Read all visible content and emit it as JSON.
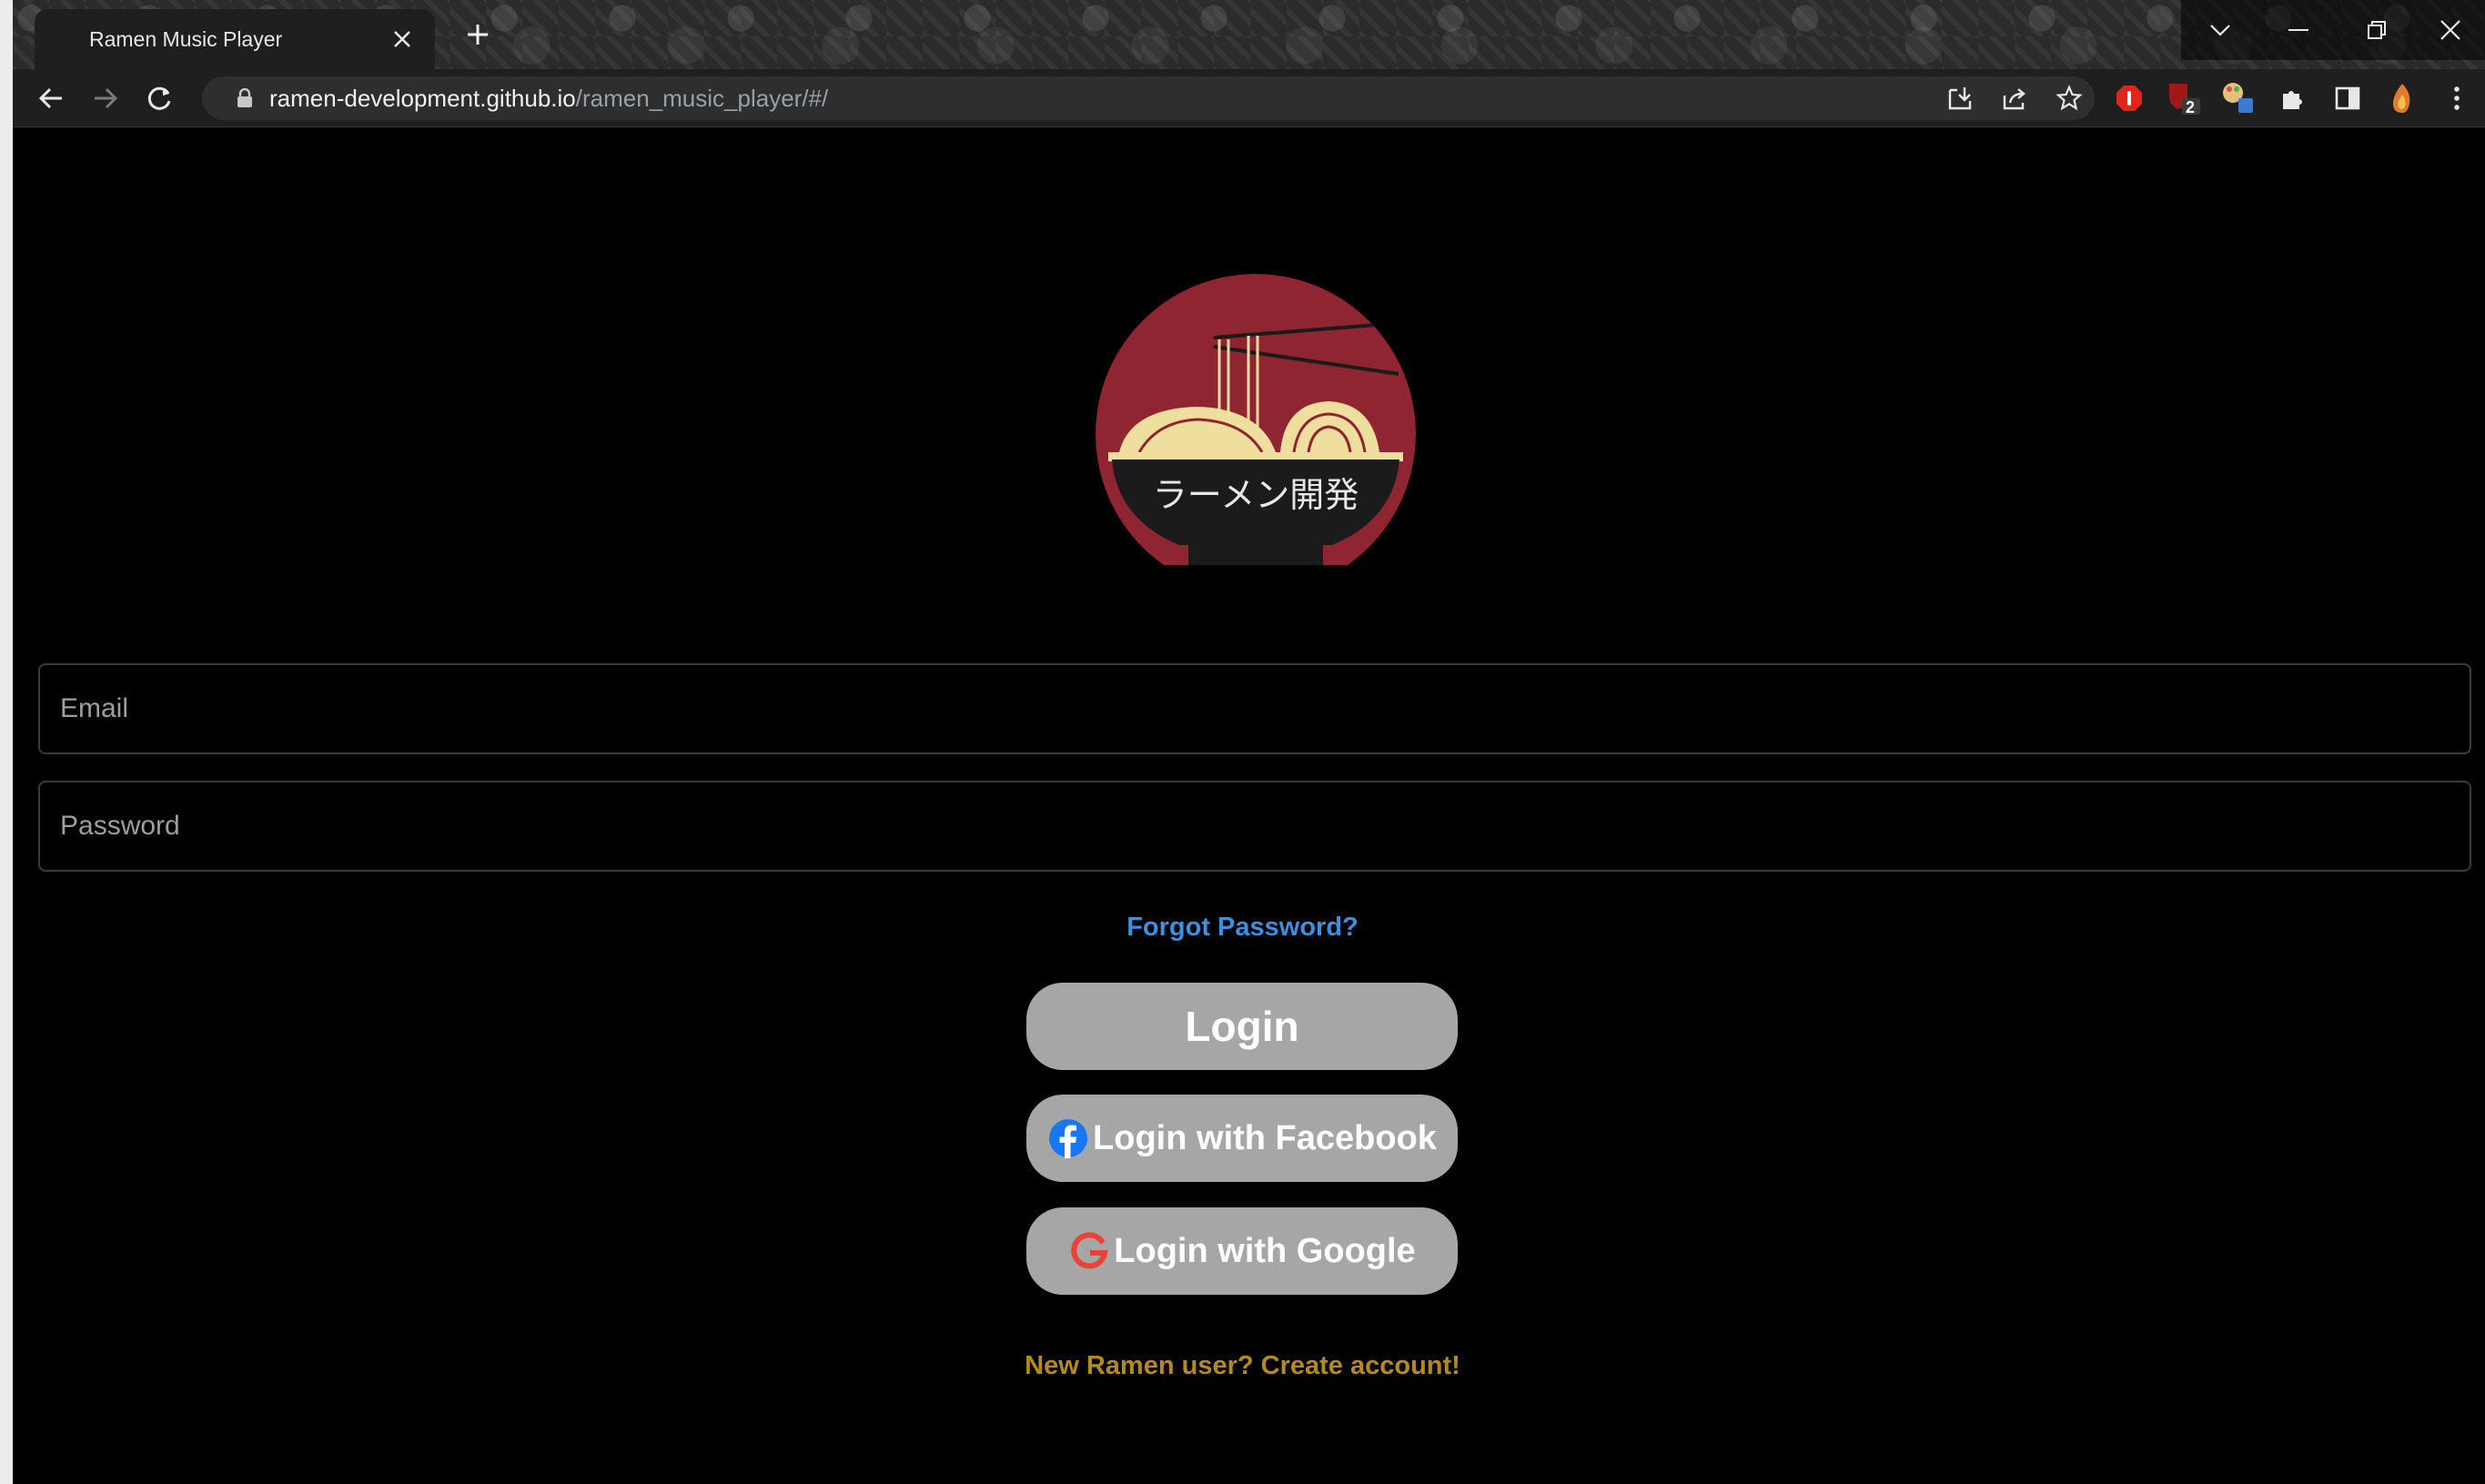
{
  "browser": {
    "tab_title": "Ramen Music Player",
    "url_host": "ramen-development.github.io",
    "url_path": "/ramen_music_player/#/",
    "extension_badge": "2"
  },
  "logo": {
    "text": "ラーメン開発",
    "colors": {
      "circle": "#8f2530",
      "noodles": "#efdf9f",
      "bowl": "#1b1b1b"
    }
  },
  "form": {
    "email_placeholder": "Email",
    "password_placeholder": "Password",
    "forgot_password": "Forgot Password?",
    "login_label": "Login",
    "facebook_label": "Login with Facebook",
    "google_label": "Login with Google",
    "create_account": "New Ramen user? Create account!"
  },
  "colors": {
    "link_blue": "#3d8fe0",
    "create_account_gold": "#b58a1c",
    "button_gray": "#a6a6a6",
    "facebook_blue": "#1877f2",
    "google_red": "#ea4335"
  }
}
